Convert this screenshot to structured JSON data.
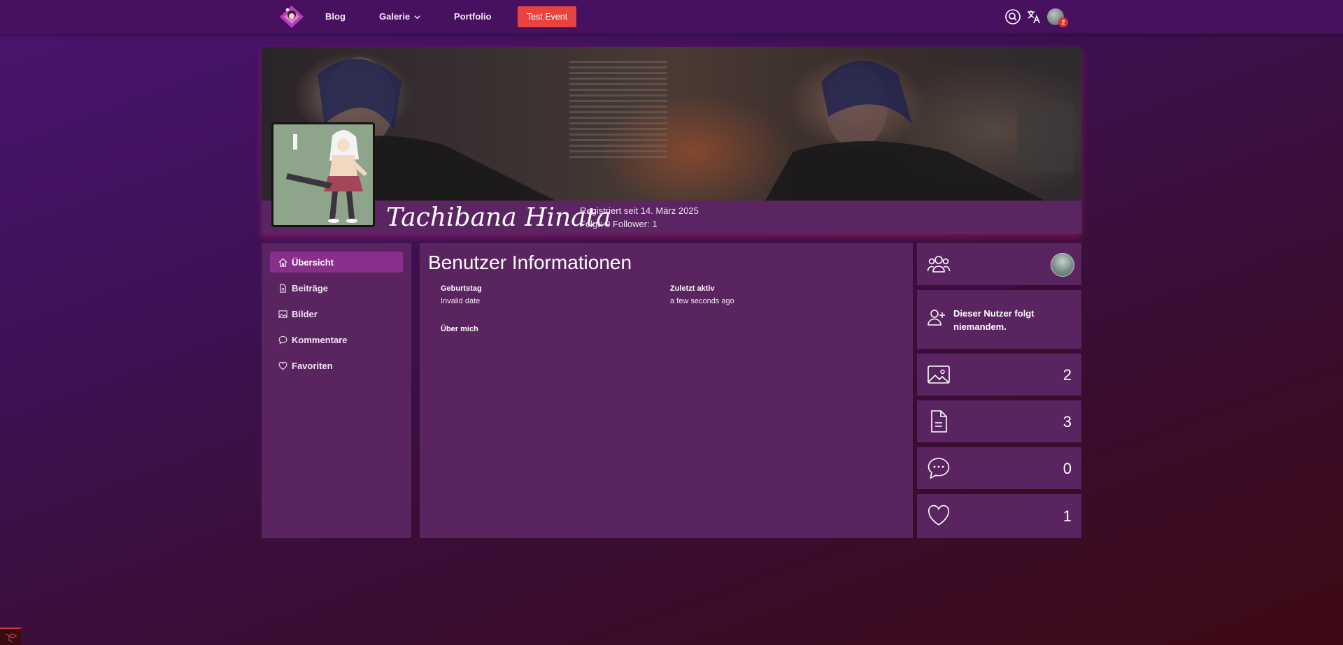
{
  "nav": {
    "items": [
      {
        "label": "Blog"
      },
      {
        "label": "Galerie"
      },
      {
        "label": "Portfolio"
      }
    ],
    "event_button": "Test Event",
    "notification_count": "2",
    "icons": [
      "logo",
      "search-icon",
      "translate-icon",
      "user-avatar"
    ]
  },
  "profile": {
    "username": "Tachibana Hinata",
    "registered": "Registriert seit 14. März 2025",
    "follow_stats": "Folgt: 0 Follower: 1"
  },
  "sidebar": {
    "items": [
      {
        "label": "Übersicht",
        "icon": "home-icon",
        "active": true
      },
      {
        "label": "Beiträge",
        "icon": "document-icon",
        "active": false
      },
      {
        "label": "Bilder",
        "icon": "image-icon",
        "active": false
      },
      {
        "label": "Kommentare",
        "icon": "comment-icon",
        "active": false
      },
      {
        "label": "Favoriten",
        "icon": "heart-icon",
        "active": false
      }
    ]
  },
  "main": {
    "title": "Benutzer Informationen",
    "birthday_label": "Geburtstag",
    "birthday_value": "Invalid date",
    "last_active_label": "Zuletzt aktiv",
    "last_active_value": "a few seconds ago",
    "about_label": "Über mich"
  },
  "stats": {
    "following_text": "Dieser Nutzer folgt niemandem.",
    "images": "2",
    "posts": "3",
    "comments": "0",
    "favorites": "1"
  },
  "colors": {
    "accent": "#8a2e8c",
    "panel": "#5a2461",
    "navbar": "#48115f",
    "event_button": "#e8433f"
  }
}
